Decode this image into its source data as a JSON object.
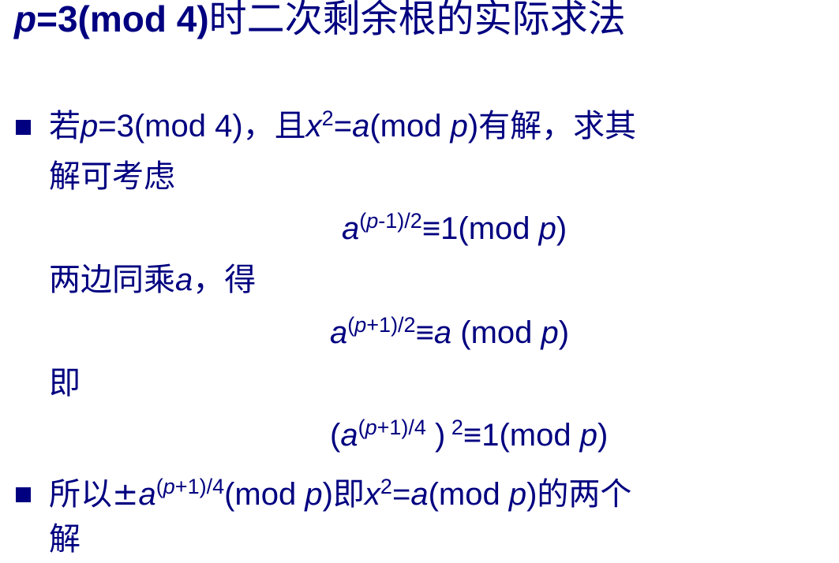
{
  "title": {
    "var_p": "p",
    "rest": "=3(mod 4)",
    "cjk": "时二次剩余根的实际求法"
  },
  "bullet1": {
    "lead_cjk": "若",
    "p1": "p",
    "mid1": "=3(mod 4)",
    "mid_cjk": "，且",
    "x": "x",
    "sup2": "2",
    "eq": "=",
    "a": "a",
    "mod_open": "(mod ",
    "p2": "p",
    "close": ")",
    "tail_cjk": "有解，求其",
    "line2_cjk": "解可考虑"
  },
  "eq1": {
    "a": "a",
    "sup_open": "(",
    "sup_p": "p",
    "sup_rest": "-1)/2",
    "mid": "≡1(mod ",
    "p": "p",
    "close": ")"
  },
  "line_both": {
    "cjk1": "两边同乘",
    "a": "a",
    "cjk2": "，得"
  },
  "eq2": {
    "a": "a",
    "sup_open": "(",
    "sup_p": "p",
    "sup_rest": "+1)/2",
    "mid": "≡",
    "a2": "a",
    "mod": " (mod ",
    "p": "p",
    "close": ")"
  },
  "line_ji": {
    "cjk": "即"
  },
  "eq3": {
    "open": "(",
    "a": "a",
    "sup_open": "(",
    "sup_p": "p",
    "sup_rest": "+1)/4",
    "mid": " )",
    "sup2": " 2",
    "rest": "≡1(mod ",
    "p": "p",
    "close": ")"
  },
  "bullet2": {
    "lead_cjk": "所以±",
    "a": "a",
    "sup_open": "(",
    "sup_p": "p",
    "sup_rest": "+1)/4",
    "mod_open": "(mod ",
    "p1": "p",
    "close1": ")",
    "ji_cjk": "即",
    "x": "x",
    "sup2": "2",
    "eq": "=",
    "a2": "a",
    "mod_open2": "(mod ",
    "p2": "p",
    "close2": ")",
    "tail_cjk": "的两个",
    "line2_cjk": "解"
  },
  "colors": {
    "text": "#000080",
    "background": "#ffffff"
  }
}
